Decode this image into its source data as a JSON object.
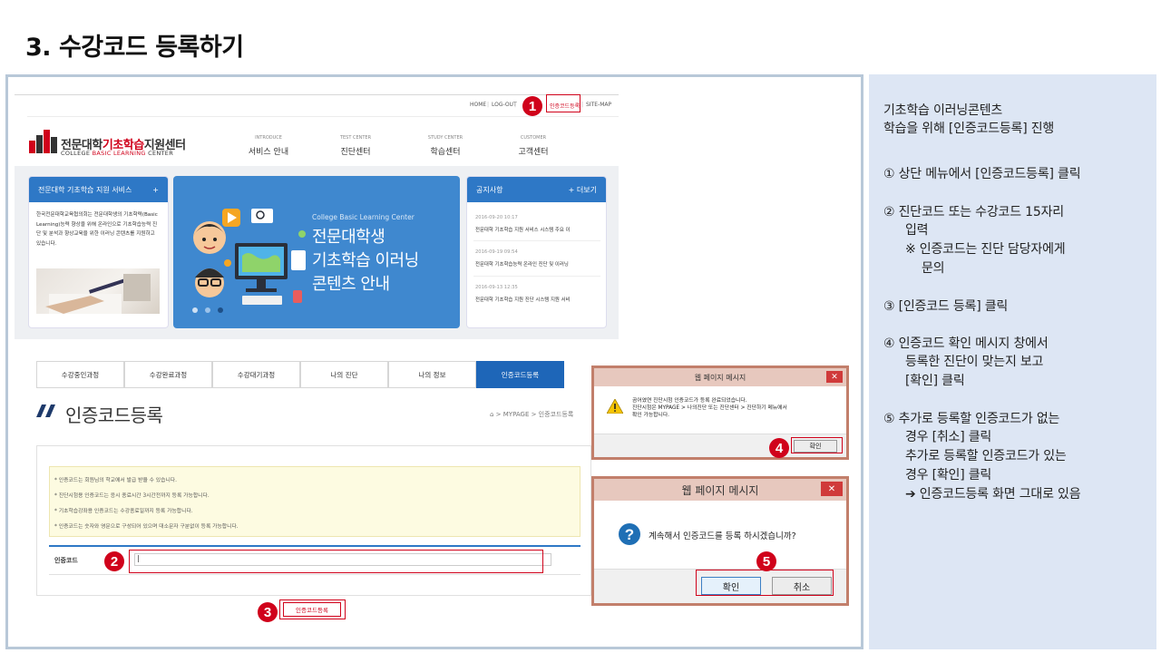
{
  "slide": {
    "title": "3. 수강코드 등록하기"
  },
  "site": {
    "top_links": [
      "HOME",
      "LOG-OUT",
      "인증코드등록",
      "SITE-MAP"
    ],
    "logo": {
      "mark": "CBLC",
      "name_a": "전문대학",
      "name_b": "기초학습",
      "name_c": "지원센터",
      "sub_a": "COLLEGE ",
      "sub_b": "BASIC LEARNING",
      "sub_c": " CENTER"
    },
    "nav": [
      {
        "en": "INTRODUCE",
        "ko": "서비스 안내"
      },
      {
        "en": "TEST CENTER",
        "ko": "진단센터"
      },
      {
        "en": "STUDY CENTER",
        "ko": "학습센터"
      },
      {
        "en": "CUSTOMER",
        "ko": "고객센터"
      }
    ],
    "service_panel": {
      "title": "전문대학 기초학습 지원 서비스",
      "plus": "+",
      "text": "한국전문대학교육협의회는 전문대학생의 기초학력(Basic Learning)능력 향상을 위해 온라인으로 기초학습능력 진단 및 분석과 향상교육을 위한 이러닝 콘텐츠를 지원하고 있습니다."
    },
    "banner": {
      "sub": "College Basic Learning Center",
      "line1": "전문대학생",
      "line2": "기초학습 이러닝",
      "line3": "콘텐츠 안내"
    },
    "notice_panel": {
      "title": "공지사항",
      "more": "+ 더보기",
      "items": [
        {
          "date": "2016-09-20 10:17",
          "title": "전문대학 기초학습 지원 서비스 시스템 주요 이"
        },
        {
          "date": "2016-09-19 09:54",
          "title": "전문대학 기초학습능력 온라인 진단 및 이러닝"
        },
        {
          "date": "2016-09-13 12:35",
          "title": "전문대학 기초학습 지원 진단 시스템 지원 서비"
        }
      ]
    }
  },
  "mypage": {
    "tabs": [
      "수강중인과정",
      "수강완료과정",
      "수강대기과정",
      "나의 진단",
      "나의 정보",
      "인증코드등록"
    ],
    "title": "인증코드등록",
    "breadcrumb": "⌂  >  MYPAGE  >  인증코드등록",
    "notices": [
      "* 인증코드는 회원님의 학교에서 발급 받을 수 있습니다.",
      "* 진단시험용 인증코드는 응시 종료시간 3시간전까지 등록 가능합니다.",
      "* 기초학습강좌용 인증코드는 수강종료일까지 등록 가능합니다.",
      "* 인증코드는 숫자와 영문으로 구성되어 있으며 대소문자 구분없이 등록 가능합니다."
    ],
    "code_label": "인증코드",
    "code_value": "|",
    "register_label": "인증코드등록"
  },
  "dialog1": {
    "title": "웹 페이지 메시지",
    "close": "✕",
    "line1": "곰어였연 진단시험 인증코드가 등록 완료되었습니다.",
    "line2": "진단시험은 MYPAGE > 나의진단 또는 진단센터 > 진단하기 메뉴에서",
    "line3": "확인 가능합니다.",
    "ok_label": "확인"
  },
  "dialog2": {
    "title": "웹 페이지 메시지",
    "close": "✕",
    "message": "계속해서 인증코드를 등록 하시겠습니까?",
    "ok_label": "확인",
    "cancel_label": "취소"
  },
  "markers": [
    "1",
    "2",
    "3",
    "4",
    "5"
  ],
  "instructions": {
    "intro1": "기초학습 이러닝콘텐츠",
    "intro2": "학습을 위해 [인증코드등록] 진행",
    "s1": "① 상단 메뉴에서 [인증코드등록] 클릭",
    "s2a": "② 진단코드 또는 수강코드 15자리",
    "s2b": "입력",
    "s2c": "※ 인증코드는 진단 담당자에게",
    "s2d": "문의",
    "s3": "③ [인증코드 등록] 클릭",
    "s4a": "④ 인증코드 확인 메시지 창에서",
    "s4b": "등록한 진단이 맞는지 보고",
    "s4c": "[확인] 클릭",
    "s5a": "⑤ 추가로 등록할 인증코드가 없는",
    "s5b": "경우 [취소] 클릭",
    "s5c": "추가로 등록할 인증코드가 있는",
    "s5d": "경우 [확인] 클릭",
    "s5e": "➔ 인증코드등록 화면 그대로 있음"
  },
  "colors": {
    "accent": "#d0021b",
    "brand_blue": "#2e78c6",
    "panel_bg": "#dde6f4",
    "dialog_border": "#c27f6b"
  }
}
